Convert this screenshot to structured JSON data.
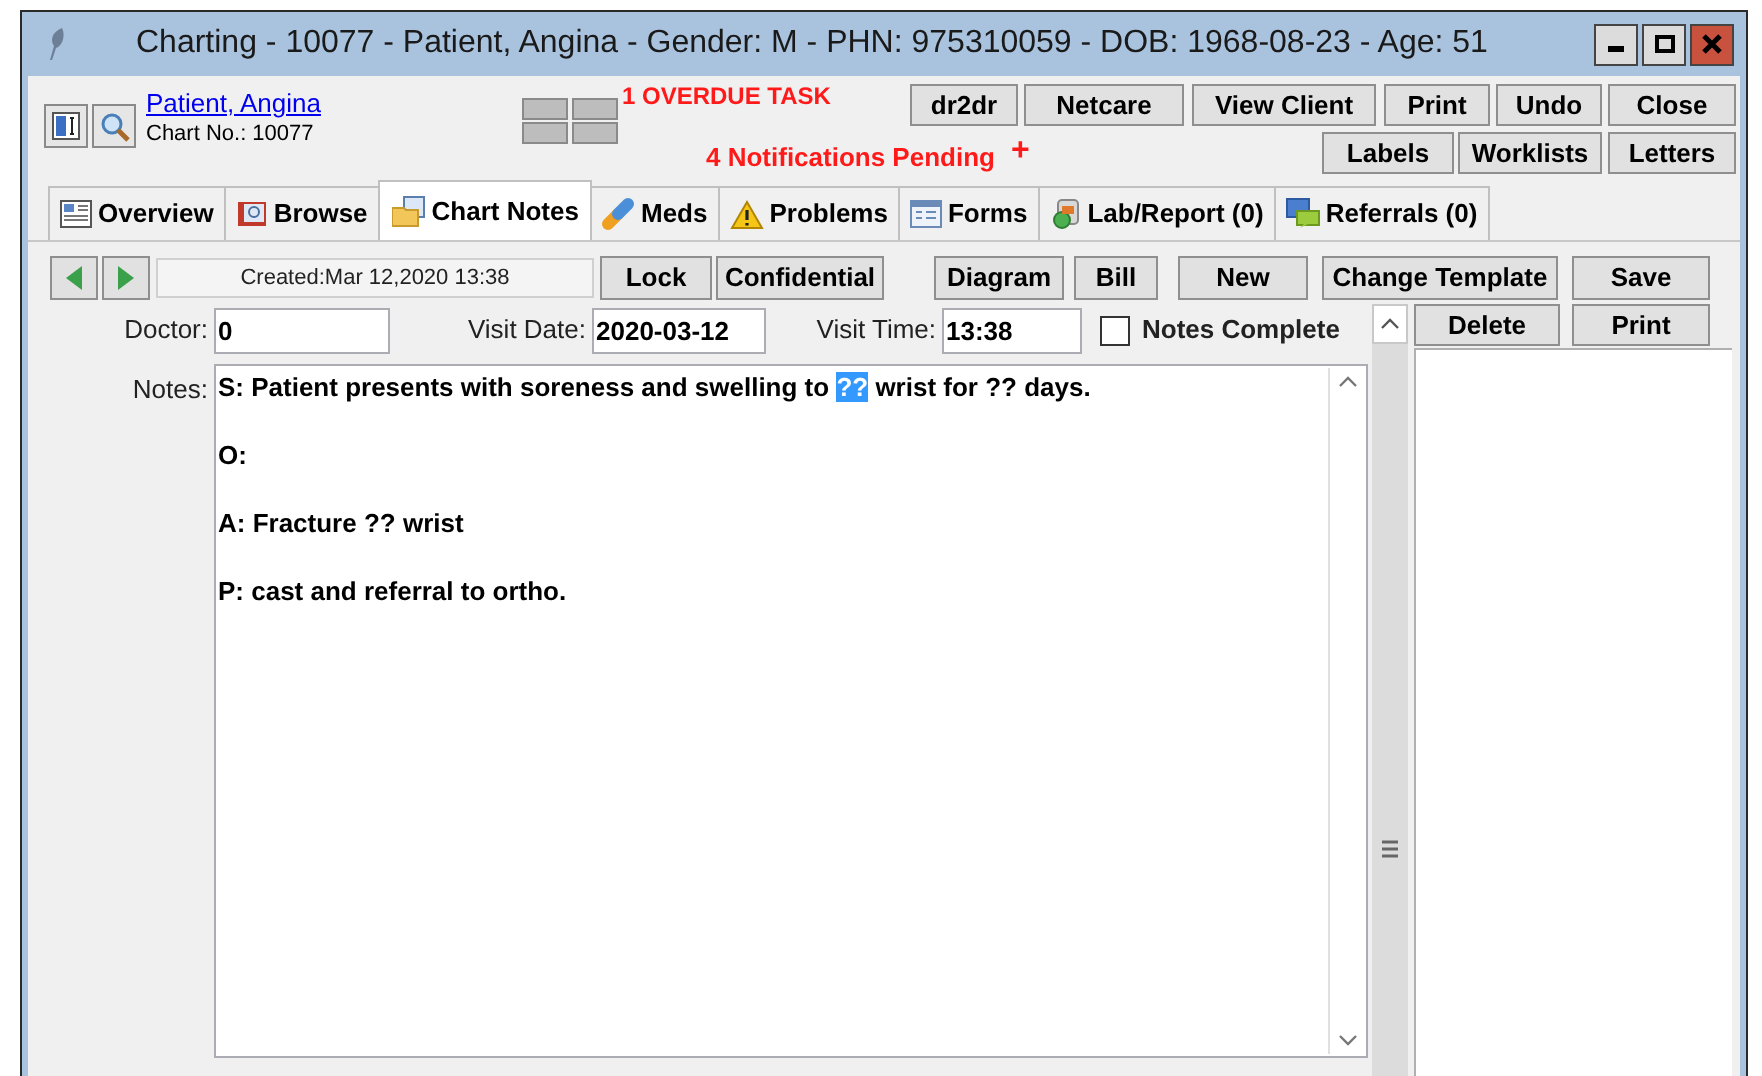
{
  "window": {
    "title": "Charting - 10077 - Patient, Angina - Gender: M - PHN: 975310059 - DOB: 1968-08-23 - Age: 51"
  },
  "patient": {
    "name": "Patient, Angina",
    "chart_no": "Chart No.: 10077"
  },
  "alerts": {
    "overdue": "1 OVERDUE TASK",
    "notifications": "4 Notifications Pending",
    "add": "+"
  },
  "top_buttons": [
    "dr2dr",
    "Netcare",
    "View Client",
    "Print",
    "Undo",
    "Close"
  ],
  "second_buttons": [
    "Labels",
    "Worklists",
    "Letters"
  ],
  "tabs": [
    {
      "label": "Overview",
      "selected": false
    },
    {
      "label": "Browse",
      "selected": false
    },
    {
      "label": "Chart Notes",
      "selected": true
    },
    {
      "label": "Meds",
      "selected": false
    },
    {
      "label": "Problems",
      "selected": false
    },
    {
      "label": "Forms",
      "selected": false
    },
    {
      "label": "Lab/Report (0)",
      "selected": false
    },
    {
      "label": "Referrals (0)",
      "selected": false
    }
  ],
  "toolbar": {
    "created": "Created:Mar 12,2020 13:38",
    "buttons": [
      "Lock",
      "Confidential",
      "Diagram",
      "Bill",
      "New",
      "Change Template",
      "Save"
    ]
  },
  "fields": [
    {
      "label": "Doctor:",
      "value": "0"
    },
    {
      "label": "Visit Date:",
      "value": "2020-03-12"
    },
    {
      "label": "Visit Time:",
      "value": "13:38"
    }
  ],
  "notes_complete": {
    "label": "Notes Complete",
    "checked": false
  },
  "side_buttons": [
    "Delete",
    "Print"
  ],
  "notes": {
    "label": "Notes:",
    "lines": [
      [
        {
          "text": "S: Patient presents with soreness and swelling to ",
          "selected": false
        },
        {
          "text": "??",
          "selected": true
        },
        {
          "text": " wrist for ?? days.",
          "selected": false
        }
      ],
      [
        {
          "text": "O:",
          "selected": false
        }
      ],
      [
        {
          "text": "A: Fracture ?? wrist",
          "selected": false
        }
      ],
      [
        {
          "text": "P: cast and referral to ortho.",
          "selected": false
        }
      ]
    ]
  }
}
